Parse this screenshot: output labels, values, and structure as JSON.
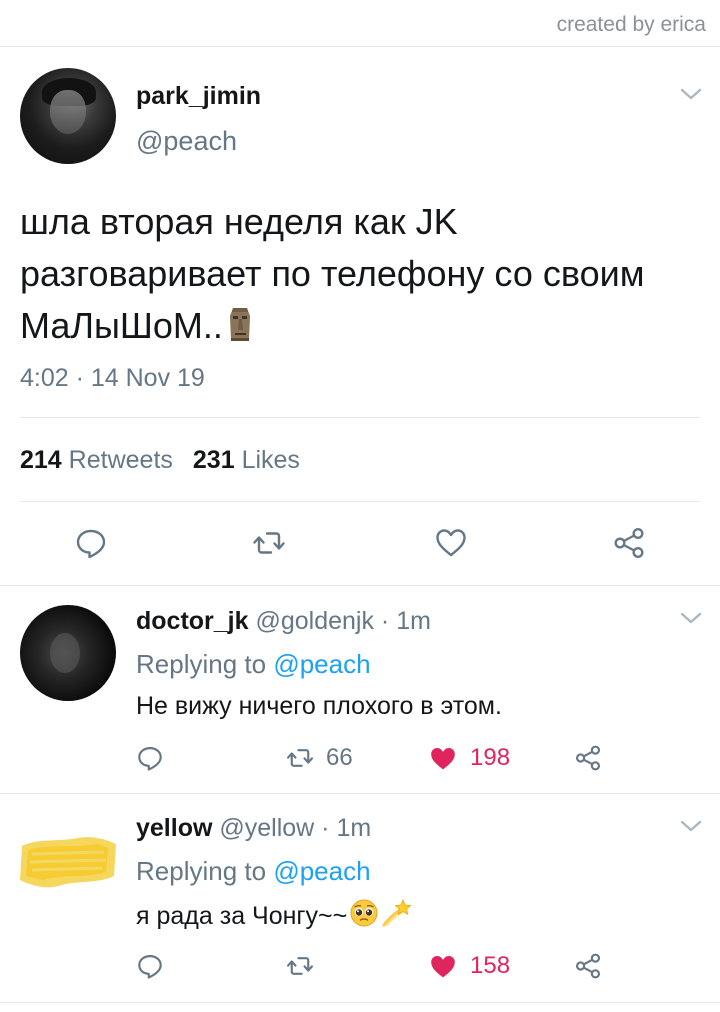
{
  "watermark": "created by erica",
  "main_tweet": {
    "display_name": "park_jimin",
    "handle": "@peach",
    "text": "шла вторая неделя как JK разговаривает по телефону со своим МаЛыШоМ..",
    "emoji": "moai",
    "timestamp": "4:02 · 14 Nov 19",
    "retweets_count": "214",
    "retweets_label": "Retweets",
    "likes_count": "231",
    "likes_label": "Likes"
  },
  "replies": [
    {
      "display_name": "doctor_jk",
      "handle_time": "@goldenjk · 1m",
      "replying_prefix": "Replying to ",
      "replying_to": "@peach",
      "text": "Не вижу ничего плохого в этом.",
      "retweets": "66",
      "likes": "198",
      "liked": true
    },
    {
      "display_name": "yellow",
      "handle_time": "@yellow · 1m",
      "replying_prefix": "Replying to ",
      "replying_to": "@peach",
      "text": "я рада за Чонгу~~",
      "emojis": [
        "pleading-face",
        "dizzy"
      ],
      "retweets": "",
      "likes": "158",
      "liked": true
    }
  ],
  "colors": {
    "text": "#14171a",
    "secondary": "#657786",
    "link": "#1da1f2",
    "like": "#e0245e",
    "divider": "#e1e8ed"
  }
}
